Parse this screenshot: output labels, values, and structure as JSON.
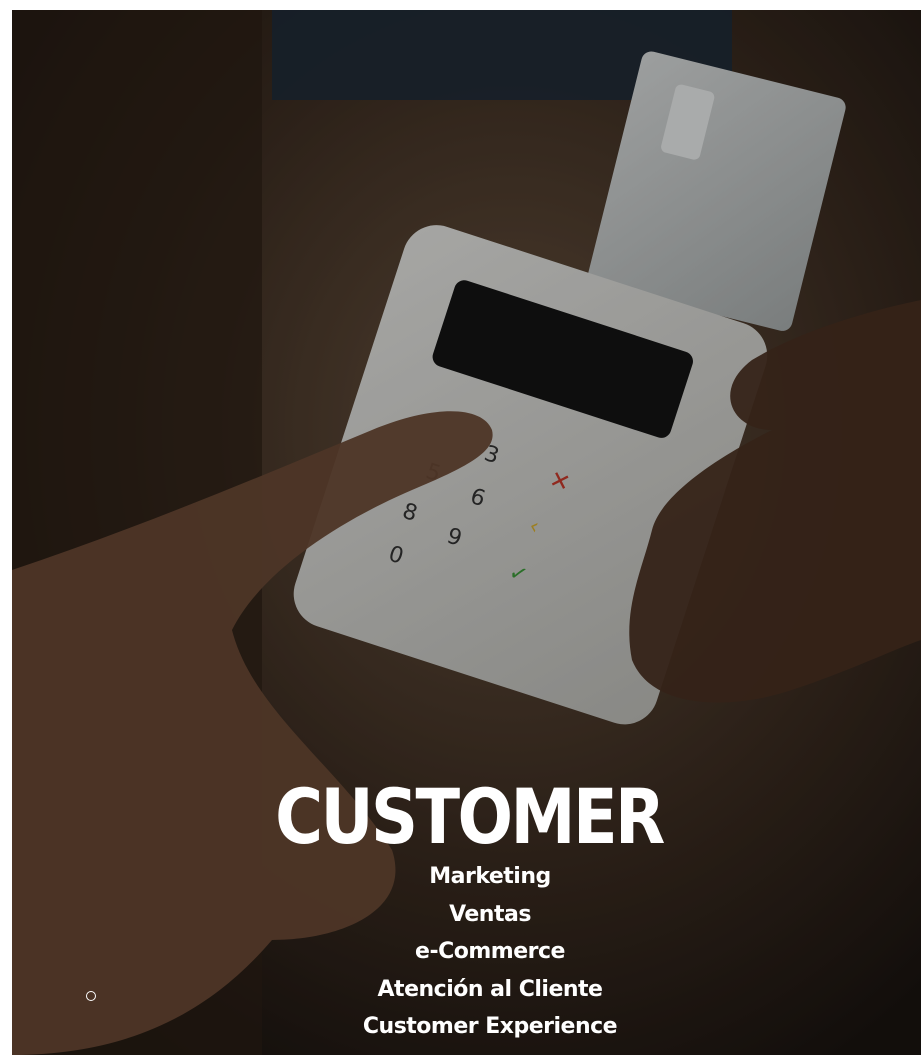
{
  "hero": {
    "title": "CUSTOMER",
    "background": "card-payment-terminal-photo"
  },
  "menu": {
    "items": [
      {
        "label": "Marketing"
      },
      {
        "label": "Ventas"
      },
      {
        "label": "e-Commerce"
      },
      {
        "label": "Atención al Cliente"
      },
      {
        "label": "Customer Experience"
      }
    ]
  },
  "colors": {
    "text": "#ffffff",
    "background": "#2a1f17"
  }
}
